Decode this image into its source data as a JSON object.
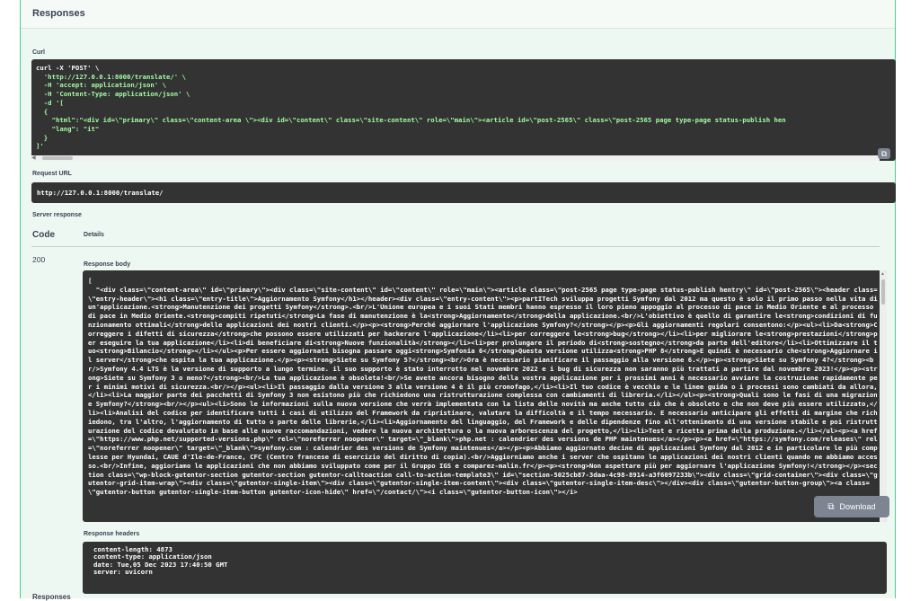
{
  "responses_title": "Responses",
  "curl": {
    "label": "Curl",
    "lines": [
      "curl -X 'POST' \\",
      "  'http://127.0.0.1:8000/translate/' \\",
      "  -H 'accept: application/json' \\",
      "  -H 'Content-Type: application/json' \\",
      "  -d '[",
      "  {",
      "    \"html\":\"<div id=\\\"primary\\\" class=\\\"content-area \\\"><div id=\\\"content\\\" class=\\\"site-content\\\" role=\\\"main\\\"><article id=\\\"post-2565\\\" class=\\\"post-2565 page type-page status-publish hen",
      "    \"lang\": \"it\"",
      "  }",
      "]'"
    ]
  },
  "request_url": {
    "label": "Request URL",
    "value": "http://127.0.0.1:8000/translate/"
  },
  "server_response_label": "Server response",
  "table": {
    "code_header": "Code",
    "details_header": "Details"
  },
  "response": {
    "code": "200",
    "body_label": "Response body",
    "body": "[\n  \"<div class=\\\"content-area\\\" id=\\\"primary\\\"><div class=\\\"site-content\\\" id=\\\"content\\\" role=\\\"main\\\"><article class=\\\"post-2565 page type-page status-publish hentry\\\" id=\\\"post-2565\\\"><header class=\\\"entry-header\\\"><h1 class=\\\"entry-title\\\">Aggiornamento Symfony</h1></header><div class=\\\"entry-content\\\"><p>partITech sviluppa progetti Symfony dal 2012 ma questo è solo il primo passo nella vita di un'applicazione.<strong>Manutenzione dei progetti Symfony</strong>.<br/>L'Unione europea e i suoi Stati membri hanno espresso il loro pieno appoggio al processo di pace in Medio Oriente e al processo di pace in Medio Oriente.<strong>compiti ripetuti</strong>La fase di manutenzione è la<strong>Aggiornamento</strong>della applicazione.<br/>L'obiettivo è quello di garantire le<strong>condizioni di funzionamento ottimali</strong>delle applicazioni dei nostri clienti.</p><p><strong>Perché aggiornare l'applicazione Symfony?</strong></p><p>Gli aggiornamenti regolari consentono:</p><ul><li>Da<strong>Correggere i difetti di sicurezza</strong>che possono essere utilizzati per hackerare l'applicazione</li><li>per correggere le<strong>bug</strong></li><li>per migliorare le<strong>prestazioni</strong>per eseguire la tua applicazione</li><li>di beneficiare di<strong>Nuove funzionalità</strong></li><li>per prolungare il periodo di<strong>sostegno</strong>da parte dell'editore</li><li>Ottimizzare il tuo<strong>Bilancio</strong></li></ul><p>Per essere aggiornati bisogna passare oggi<strong>Symfonia 6</strong>Questa versione utilizza<strong>PHP 8</strong>E quindi è necessario che<strong>Aggiornare il server</strong>che ospita la tua applicazione.</p><p><strong>Siete su Symfony 5?</strong><br/>Ora è necessario pianificare il passaggio alla versione 6.</p><p><strong>Siete su Symfony 4?</strong><br/>Symfony 4.4 LTS è la versione di supporto a lungo termine. il suo supporto è stato interrotto nel novembre 2022 e i bug di sicurezza non saranno più trattati a partire dal novembre 2023!</p><p><strong>Siete su Symfony 3 o meno?</strong><br/>La tua applicazione è obsoleta!<br/>Se avete ancora bisogno della vostra applicazione per i prossimi anni è necessario avviare la costruzione rapidamente per i minimi motivi di sicurezza.<br/></p><ul><li>Il passaggio dalla versione 3 alla versione 4 è il più cronofago,</li><li>Il tuo codice è vecchio e le linee guida o i processi sono cambiati da allora,</li><li>La maggior parte dei pacchetti di Symfony 3 non esistono più che richiedono una ristrutturazione complessa con cambiamenti di libreria.</li></ul><p><strong>Quali sono le fasi di una migrazione Symfony?</strong><br/></p><ul><li>Sono le informazioni sulla nuova versione che verrà implementata con la lista delle novità ma anche tutto ciò che è obsoleto e che non deve più essere utilizzato,</li><li>Analisi del codice per identificare tutti i casi di utilizzo del Framework da ripristinare, valutare la difficoltà e il tempo necessario. E necessario anticipare gli effetti di margine che richiedono, tra l'altro, l'aggiornamento di tutto o parte delle librerie,</li><li>Aggiornamento del linguaggio, del Framework e delle dipendenze fino all'ottenimento di una versione stabile e poi ristrutturazione del codice devalutato in base alle nuove raccomandazioni, vedere la nuova architettura o la nuova arborescenza del progetto,</li><li>Test e ricetta prima della produzione.</li></ul><p><a href=\\\"https://www.php.net/supported-versions.php\\\" rel=\\\"noreferrer noopener\\\" target=\\\"_blank\\\">php.net : calendrier des versions de PHP maintenues</a></p><p><a href=\\\"https://symfony.com/releases\\\" rel=\\\"noreferrer noopener\\\" target=\\\"_blank\\\">symfony.com : calendrier des versions de Symfony maintenues</a></p><p>Abbiamo aggiornato decine di applicazioni Symfony dal 2012 e in particolare le più complesse per Hyundai, CAUE d'Ile-de-France, CFC (Centro francese di esercizio del diritto di copia).<br/>Aggiorniamo anche i server che ospitano le applicazioni dei nostri clienti quando ne abbiamo accesso.<br/>Infine, aggioriamo le applicazioni che non abbiamo sviluppato come per il Gruppo IGS e comparez-malin.fr</p><p><strong>Non aspettare più per aggiornare l'applicazione Symfony!</strong></p><section class=\\\"wp-block-gutentor-section gutentor-section gutentor-calltoaction call-to-action-template3\\\" id=\\\"section-5025cb87-3daa-4c98-8914-a3f6097233b\\\"><div class=\\\"grid-container\\\"><div class=\\\"gutentor-grid-item-wrap\\\"><div class=\\\"gutentor-single-item\\\"><div class=\\\"gutentor-single-item-content\\\"><div class=\\\"gutentor-single-item-desc\\\"></div><div class=\\\"gutentor-button-group\\\"><a class=\\\"gutentor-button gutentor-single-item-button gutentor-icon-hide\\\" href=\\\"/contact/\\\"><i class=\\\"gutentor-button-icon\\\"></i>",
    "download_label": "Download",
    "headers_label": "Response headers",
    "headers": [
      "content-length: 4873",
      "content-type: application/json",
      "date: Tue,05 Dec 2023 17:40:50 GMT",
      "server: uvicorn"
    ]
  },
  "bottom_label": "Responses",
  "colors": {
    "panel_bg": "#eef8f3",
    "panel_border": "#49cc90",
    "code_bg": "#333333",
    "button_bg": "#7d8492"
  },
  "icons": {
    "copy": "copy-icon",
    "download": "copy-icon"
  }
}
